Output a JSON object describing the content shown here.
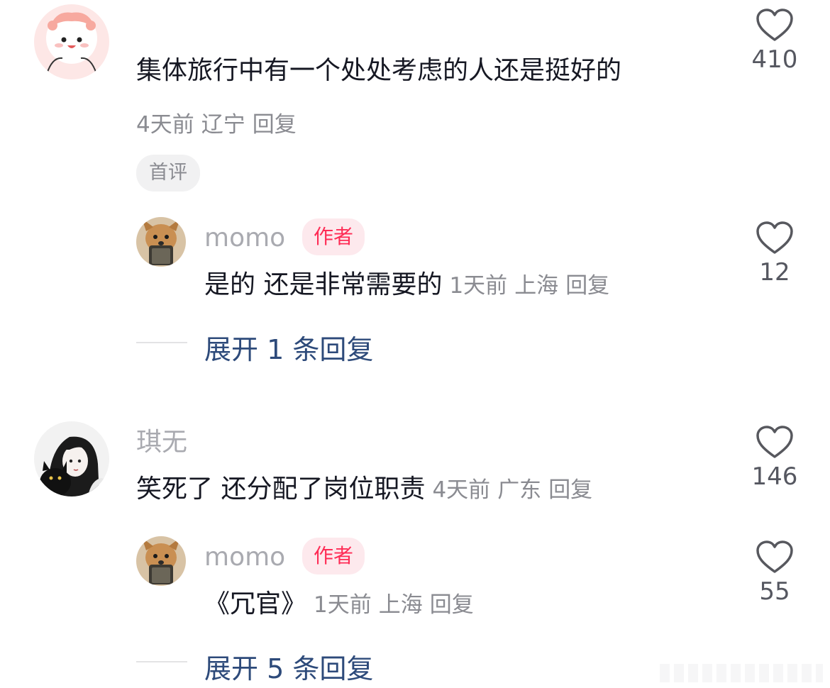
{
  "comments": [
    {
      "avatar": "cartoon-pink-character",
      "text": "集体旅行中有一个处处考虑的人还是挺好的",
      "time": "4天前",
      "location": "辽宁",
      "reply_label": "回复",
      "tag": "首评",
      "likes": "410",
      "replies": [
        {
          "avatar": "dog-photo",
          "username": "momo",
          "badge": "作者",
          "text": "是的 还是非常需要的",
          "time": "1天前",
          "location": "上海",
          "reply_label": "回复",
          "likes": "12"
        }
      ],
      "expand_label": "展开 1 条回复"
    },
    {
      "avatar": "anime-girl-with-cat",
      "username": "琪无",
      "text": "笑死了 还分配了岗位职责",
      "time": "4天前",
      "location": "广东",
      "reply_label": "回复",
      "likes": "146",
      "replies": [
        {
          "avatar": "dog-photo",
          "username": "momo",
          "badge": "作者",
          "text": "《冗官》",
          "time": "1天前",
          "location": "上海",
          "reply_label": "回复",
          "likes": "55"
        }
      ],
      "expand_label": "展开 5 条回复"
    }
  ],
  "colors": {
    "author_badge": "#fe2c55",
    "expand_link": "#2d4a7a",
    "meta": "#8a8b91"
  }
}
